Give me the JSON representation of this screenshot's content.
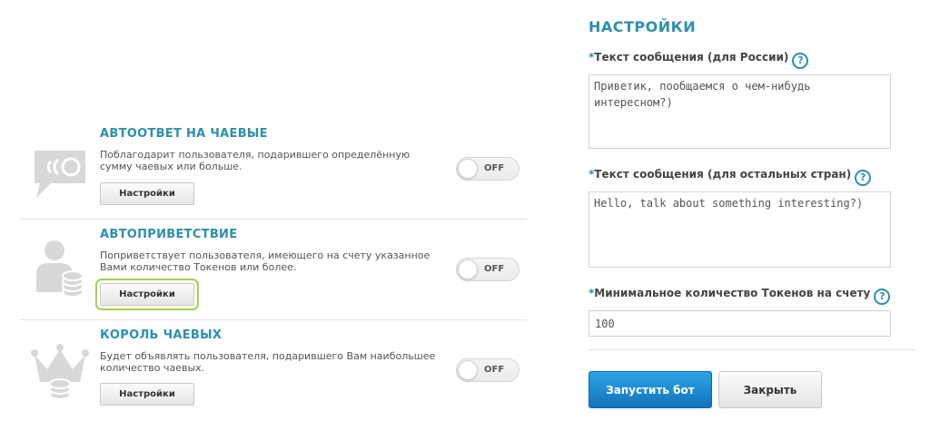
{
  "bots": [
    {
      "title": "АВТООТВЕТ НА ЧАЕВЫЕ",
      "description": "Поблагодарит пользователя, подарившего определённую сумму чаевых или больше.",
      "settings_label": "Настройки",
      "toggle_state": "OFF",
      "icon": "speech-bubble-icon"
    },
    {
      "title": "АВТОПРИВЕТСТВИЕ",
      "description": "Поприветствует пользователя, имеющего на счету указанное Вами количество Токенов или более.",
      "settings_label": "Настройки",
      "toggle_state": "OFF",
      "icon": "user-coins-icon",
      "highlighted": true
    },
    {
      "title": "КОРОЛЬ ЧАЕВЫХ",
      "description": "Будет объявлять пользователя, подарившего Вам наибольшее количество чаевых.",
      "settings_label": "Настройки",
      "toggle_state": "OFF",
      "icon": "crown-coins-icon"
    }
  ],
  "settings_panel": {
    "title": "НАСТРОЙКИ",
    "fields": [
      {
        "label": "Текст сообщения (для России)",
        "value": "Приветик, пообщаемся о чем-нибудь интересном?)"
      },
      {
        "label": "Текст сообщения (для остальных стран)",
        "value": "Hello, talk about something interesting?)"
      },
      {
        "label": "Минимальное количество Токенов на счету",
        "value": "100"
      }
    ],
    "required_mark": "*",
    "help_glyph": "?",
    "start_label": "Запустить бот",
    "close_label": "Закрыть"
  },
  "colors": {
    "accent": "#2d8fb0",
    "primary_button": "#1a86d0",
    "highlight": "#a6d04a",
    "icon_gray": "#d8d8d8"
  }
}
